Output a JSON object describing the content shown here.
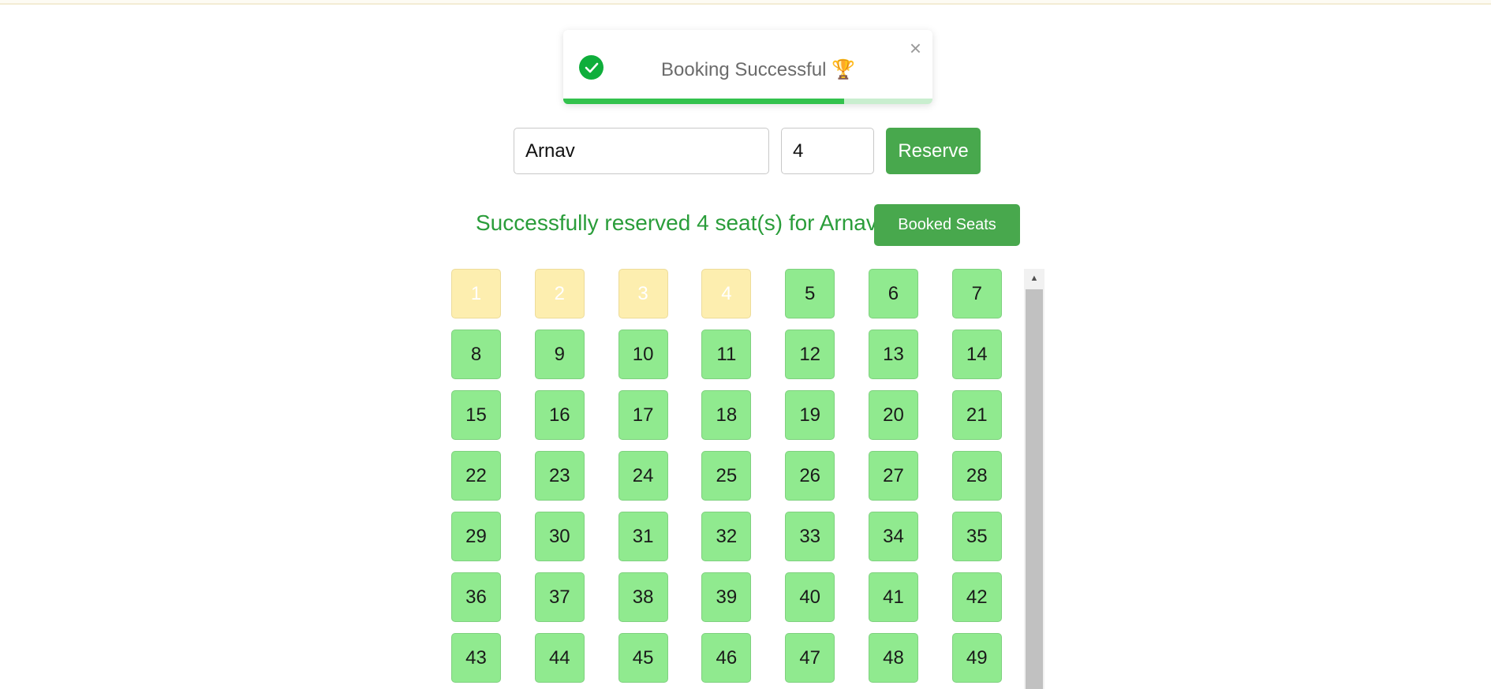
{
  "toast": {
    "message": "Booking Successful 🏆",
    "close_label": "×",
    "icon": "check-circle-icon",
    "progress": 0.76,
    "colors": {
      "icon": "#0fae3b",
      "progress": "#33c24d",
      "track": "#c9eecf"
    }
  },
  "form": {
    "name_value": "Arnav",
    "count_value": "4",
    "reserve_label": "Reserve"
  },
  "status": {
    "message": "Successfully reserved 4 seat(s) for Arnav",
    "booked_seats_label": "Booked Seats"
  },
  "seats": {
    "visible_numbers": [
      "1",
      "2",
      "3",
      "4",
      "5",
      "6",
      "7",
      "8",
      "9",
      "10",
      "11",
      "12",
      "13",
      "14",
      "15",
      "16",
      "17",
      "18",
      "19",
      "20",
      "21",
      "22",
      "23",
      "24",
      "25",
      "26",
      "27",
      "28",
      "29",
      "30",
      "31",
      "32",
      "33",
      "34",
      "35",
      "36",
      "37",
      "38",
      "39",
      "40",
      "41",
      "42",
      "43",
      "44",
      "45",
      "46",
      "47",
      "48",
      "49"
    ],
    "booked": [
      "1",
      "2",
      "3",
      "4"
    ],
    "colors": {
      "available": "#90ea8f",
      "booked": "#fdeeaf"
    }
  },
  "colors": {
    "accent": "#48a84d",
    "status_text": "#2a9d3a"
  }
}
